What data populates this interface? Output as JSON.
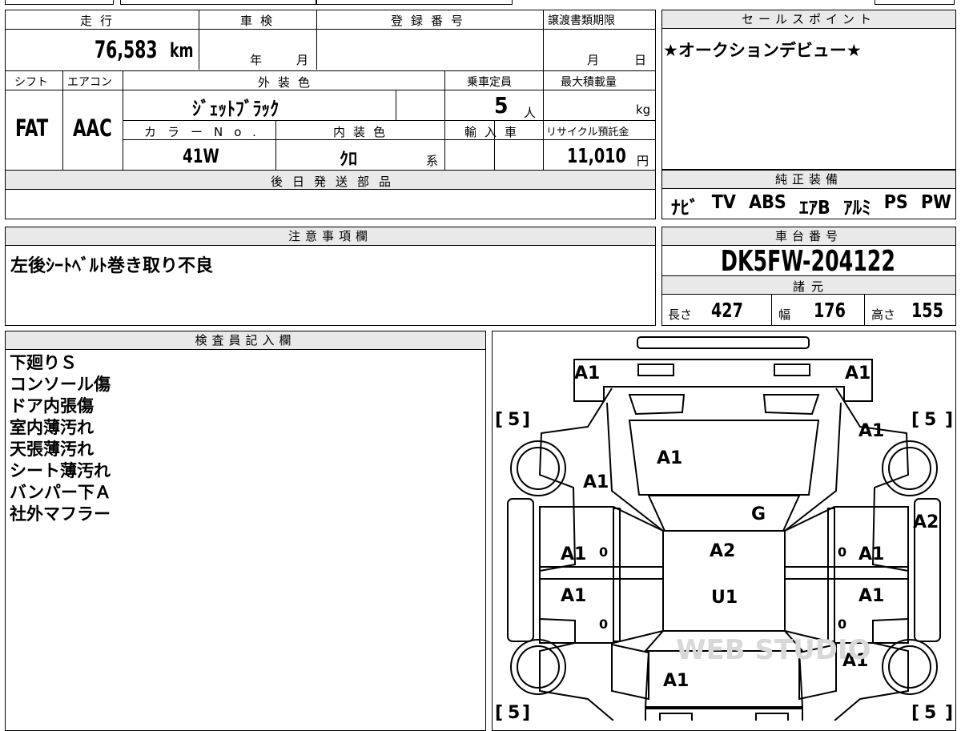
{
  "top_strip": [
    "",
    "",
    "",
    ""
  ],
  "main": {
    "mileage": {
      "label": "走行",
      "value": "76,583",
      "unit": "km"
    },
    "inspection": {
      "label": "車検",
      "year_unit": "年",
      "month_unit": "月"
    },
    "registration": {
      "label": "登録番号",
      "value": ""
    },
    "transfer_deadline": {
      "label": "譲渡書類期限",
      "month_unit": "月",
      "day_unit": "日"
    },
    "shift": {
      "label": "シフト",
      "value": "FAT"
    },
    "aircon": {
      "label": "エアコン",
      "value": "AAC"
    },
    "exterior_color": {
      "label": "外装色",
      "value": "ｼﾞｪｯﾄﾌﾞﾗｯｸ"
    },
    "capacity": {
      "label": "乗車定員",
      "value": "5",
      "unit": "人"
    },
    "max_load": {
      "label": "最大積載量",
      "value": "",
      "unit": "kg"
    },
    "color_no": {
      "label": "カラーNo.",
      "value": "41W"
    },
    "interior_color": {
      "label": "内装色",
      "value": "ｸﾛ",
      "suffix": "系"
    },
    "import_car": {
      "label": "輸入車",
      "value": ""
    },
    "recycle_fee": {
      "label": "リサイクル預託金",
      "value": "11,010",
      "unit": "円"
    },
    "later_parts": {
      "label": "後日発送部品",
      "value": ""
    }
  },
  "sales_point": {
    "label": "セールスポイント",
    "text": "★オークションデビュー★"
  },
  "equipment": {
    "label": "純正装備",
    "items": [
      "ﾅﾋﾞ",
      "TV",
      "ABS",
      "ｴｱB",
      "ｱﾙﾐ",
      "PS",
      "PW"
    ]
  },
  "caution": {
    "label": "注意事項欄",
    "text": "左後ｼｰﾄﾍﾞﾙﾄ巻き取り不良"
  },
  "chassis": {
    "label": "車台番号",
    "value": "DK5FW-204122",
    "spec_label": "諸元",
    "length_label": "長さ",
    "length": "427",
    "width_label": "幅",
    "width": "176",
    "height_label": "高さ",
    "height": "155"
  },
  "inspector": {
    "label": "検査員記入欄",
    "lines": [
      "下廻りＳ",
      "コンソール傷",
      "ドア内張傷",
      "室内薄汚れ",
      "天張薄汚れ",
      "シート薄汚れ",
      "バンパー下Ａ",
      "社外マフラー"
    ]
  },
  "diagram": {
    "marks": {
      "front_left": "A1",
      "front_right": "A1",
      "fender_fl": "A1",
      "fender_fr": "A1",
      "bonnet": "A1",
      "windshield": "G",
      "roof": "A2",
      "roof_lower": "U1",
      "door_fl": "A1",
      "door_fr": "A1",
      "door_rl": "A1",
      "door_rr": "A1",
      "side_right": "A2",
      "quarter_rr": "A1",
      "rear": "A1",
      "door_fl_zero": "0",
      "door_fr_zero": "0",
      "door_rl_zero": "0",
      "door_rr_zero": "0"
    },
    "tires": {
      "fl": "5",
      "fr": "5",
      "rl": "5",
      "rr": "5"
    },
    "watermark": "WEB STUDIO"
  }
}
